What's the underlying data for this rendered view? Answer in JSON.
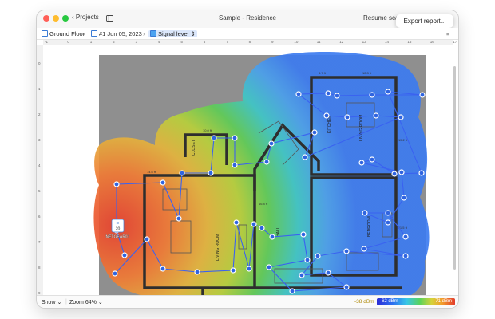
{
  "window": {
    "title": "Sample - Residence",
    "back_label": "Projects"
  },
  "toolbar": {
    "resume_label": "Resume scan",
    "export_label": "Export report..."
  },
  "breadcrumb": {
    "floor": "Ground Floor",
    "scan": "#1 Jun 05, 2023",
    "metric": "Signal level"
  },
  "ruler": {
    "top": [
      "-1",
      "0",
      "1",
      "2",
      "3",
      "4",
      "5",
      "6",
      "7",
      "8",
      "9",
      "10",
      "11",
      "12",
      "13",
      "14",
      "15",
      "16",
      "17"
    ],
    "left": [
      "0",
      "1",
      "2",
      "3",
      "4",
      "5",
      "6",
      "7",
      "8",
      "9",
      "10"
    ]
  },
  "dimensions": [
    "18.4 ft",
    "14.6 ft",
    "10.0 ft",
    "8.7 ft",
    "12.3 ft",
    "13.1 ft",
    "15.2 ft",
    "11.5 ft",
    "20.0 ft",
    "16.8 ft"
  ],
  "room_labels": [
    "LIVING ROOM",
    "LIVING ROOM",
    "BEDROOM",
    "HALL",
    "CLOSET",
    "KITCHEN"
  ],
  "access_point": {
    "label": "NETGEAR01",
    "channel": "20"
  },
  "bottom": {
    "show_label": "Show",
    "zoom_label": "Zoom 64%",
    "legend_low": "-38 dBm",
    "legend_mid": "-62 dBm",
    "legend_high": "-71 dBm"
  },
  "colors": {
    "accent": "#3a7bd5",
    "scan_point": "#2f64e0",
    "path": "#3a62f0"
  }
}
